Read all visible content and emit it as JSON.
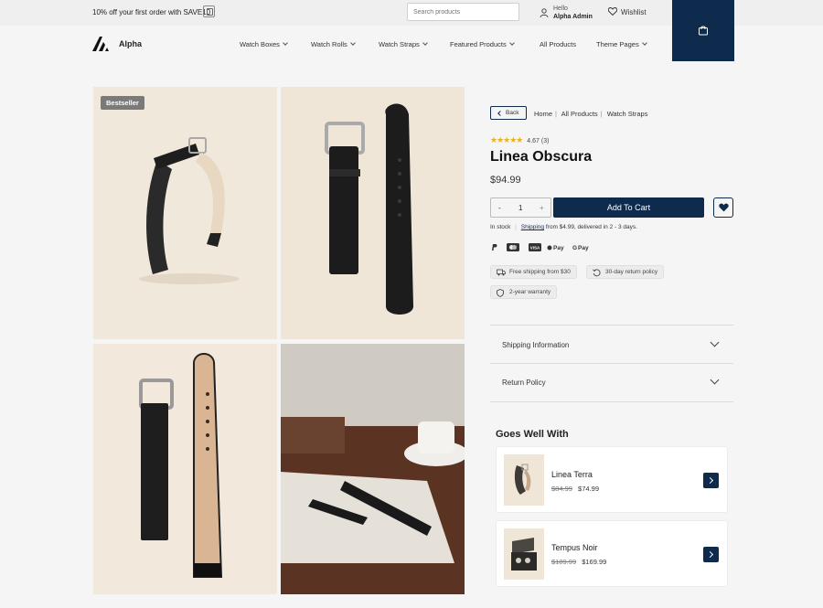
{
  "topbar": {
    "promo_text": "10% off your first order with SAVE10",
    "search_placeholder": "Search products",
    "greeting": "Hello",
    "user_name": "Alpha Admin",
    "wishlist_label": "Wishlist"
  },
  "header": {
    "brand": "Alpha",
    "menu": [
      {
        "label": "Watch Boxes",
        "has_dropdown": true
      },
      {
        "label": "Watch Rolls",
        "has_dropdown": true
      },
      {
        "label": "Watch Straps",
        "has_dropdown": true
      },
      {
        "label": "Featured Products",
        "has_dropdown": true
      },
      {
        "label": "All Products",
        "has_dropdown": false
      },
      {
        "label": "Theme Pages",
        "has_dropdown": true
      }
    ]
  },
  "gallery": {
    "badge": "Bestseller"
  },
  "product": {
    "back_label": "Back",
    "breadcrumb": [
      "Home",
      "All Products",
      "Watch Straps"
    ],
    "rating_value": "4.67",
    "rating_count": "(3)",
    "title": "Linea Obscura",
    "price": "$94.99",
    "quantity": "1",
    "add_to_cart_label": "Add To Cart",
    "stock_status": "In stock",
    "shipping_link": "Shipping",
    "shipping_text": "from $4.99, delivered in 2 - 3 days.",
    "payment_methods": [
      "PayPal",
      "Mastercard",
      "Visa",
      "Apple Pay",
      "Google Pay"
    ],
    "features": [
      "Free shipping from $30",
      "30-day return policy",
      "2-year warranty"
    ],
    "accordions": [
      "Shipping Information",
      "Return Policy"
    ]
  },
  "related": {
    "heading": "Goes Well With",
    "items": [
      {
        "name": "Linea Terra",
        "old_price": "$84.99",
        "price": "$74.99"
      },
      {
        "name": "Tempus Noir",
        "old_price": "$189.99",
        "price": "$169.99"
      }
    ]
  },
  "colors": {
    "accent": "#0e2a4d",
    "star": "#e7b325",
    "background": "#f5f5f5"
  }
}
